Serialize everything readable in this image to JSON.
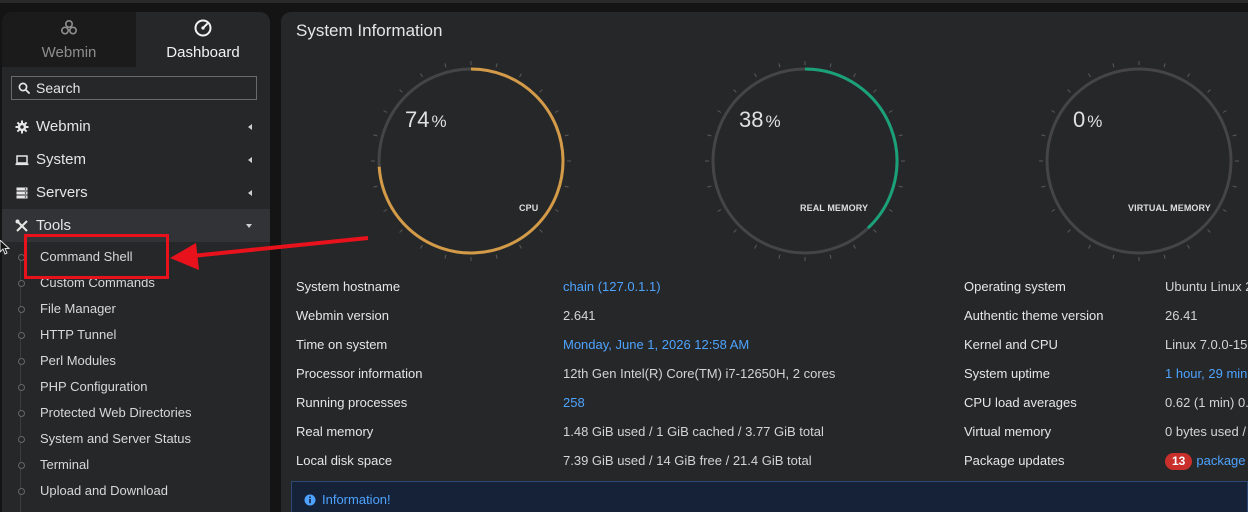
{
  "sidebar": {
    "tabs": [
      {
        "label": "Webmin",
        "icon": "webmin-logo-icon"
      },
      {
        "label": "Dashboard",
        "icon": "dashboard-gauge-icon"
      }
    ],
    "search_placeholder": "Search",
    "categories": [
      {
        "label": "Webmin",
        "icon": "gear-icon",
        "expanded": false
      },
      {
        "label": "System",
        "icon": "laptop-icon",
        "expanded": false
      },
      {
        "label": "Servers",
        "icon": "server-icon",
        "expanded": false
      },
      {
        "label": "Tools",
        "icon": "wrench-screwdriver-icon",
        "expanded": true
      }
    ],
    "tools_items": [
      "Command Shell",
      "Custom Commands",
      "File Manager",
      "HTTP Tunnel",
      "Perl Modules",
      "PHP Configuration",
      "Protected Web Directories",
      "System and Server Status",
      "Terminal",
      "Upload and Download"
    ]
  },
  "main": {
    "title": "System Information",
    "gauges": [
      {
        "value": "74",
        "unit": "%",
        "label": "CPU",
        "percent": 74,
        "color": "#d39a47"
      },
      {
        "value": "38",
        "unit": "%",
        "label": "REAL MEMORY",
        "percent": 38,
        "color": "#1aa177"
      },
      {
        "value": "0",
        "unit": "%",
        "label": "VIRTUAL MEMORY",
        "percent": 0,
        "color": "#1aa177"
      }
    ],
    "info_left": [
      {
        "label": "System hostname",
        "value": "chain (127.0.1.1)",
        "link": true
      },
      {
        "label": "Webmin version",
        "value": "2.641",
        "link": false
      },
      {
        "label": "Time on system",
        "value": "Monday, June 1, 2026 12:58 AM",
        "link": true
      },
      {
        "label": "Processor information",
        "value": "12th Gen Intel(R) Core(TM) i7-12650H, 2 cores",
        "link": false
      },
      {
        "label": "Running processes",
        "value": "258",
        "link": true
      },
      {
        "label": "Real memory",
        "value": "1.48 GiB used / 1 GiB cached / 3.77 GiB total",
        "link": false
      },
      {
        "label": "Local disk space",
        "value": "7.39 GiB used / 14 GiB free / 21.4 GiB total",
        "link": false
      }
    ],
    "info_right": [
      {
        "label": "Operating system",
        "value": "Ubuntu Linux 2",
        "link": false
      },
      {
        "label": "Authentic theme version",
        "value": "26.41",
        "link": false
      },
      {
        "label": "Kernel and CPU",
        "value": "Linux 7.0.0-15-",
        "link": false
      },
      {
        "label": "System uptime",
        "value": "1 hour, 29 minu",
        "link": true
      },
      {
        "label": "CPU load averages",
        "value": "0.62 (1 min) 0.",
        "link": false
      },
      {
        "label": "Virtual memory",
        "value": "0 bytes used /",
        "link": false
      },
      {
        "label": "Package updates",
        "badge": "13",
        "value": "package",
        "link": true
      }
    ],
    "alert": {
      "text": "Information!",
      "icon": "info-circle-icon"
    }
  },
  "colors": {
    "accent_link": "#4da3ff",
    "cpu_gauge": "#d39a47",
    "memory_gauge": "#1aa177",
    "highlight_annotation": "#e8121c",
    "badge": "#c9302c"
  }
}
